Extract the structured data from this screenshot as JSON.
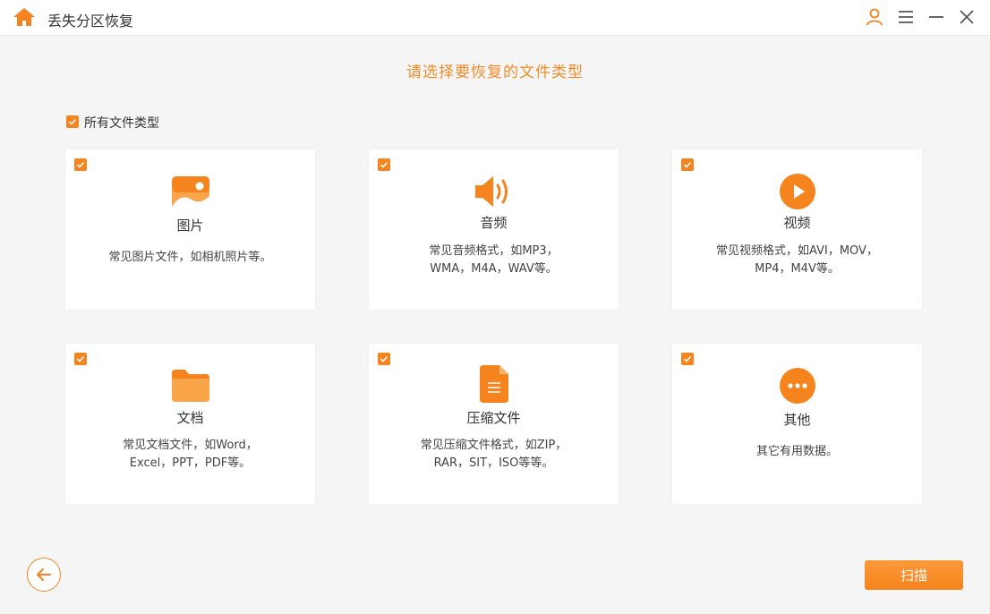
{
  "window": {
    "title": "丢失分区恢复"
  },
  "heading": "请选择要恢复的文件类型",
  "all_types": {
    "label": "所有文件类型",
    "checked": true
  },
  "cards": [
    {
      "icon": "image-icon",
      "title": "图片",
      "desc_line1": "常见图片文件，如相机照片等。",
      "desc_line2": "",
      "checked": true
    },
    {
      "icon": "audio-icon",
      "title": "音频",
      "desc_line1": "常见音频格式，如MP3，",
      "desc_line2": "WMA，M4A，WAV等。",
      "checked": true
    },
    {
      "icon": "video-play-icon",
      "title": "视频",
      "desc_line1": "常见视频格式，如AVI，MOV，",
      "desc_line2": "MP4，M4V等。",
      "checked": true
    },
    {
      "icon": "folder-icon",
      "title": "文档",
      "desc_line1": "常见文档文件，如Word，",
      "desc_line2": "Excel，PPT，PDF等。",
      "checked": true
    },
    {
      "icon": "archive-file-icon",
      "title": "压缩文件",
      "desc_line1": "常见压缩文件格式，如ZIP，",
      "desc_line2": "RAR，SIT，ISO等等。",
      "checked": true
    },
    {
      "icon": "more-icon",
      "title": "其他",
      "desc_line1": "其它有用数据。",
      "desc_line2": "",
      "checked": true
    }
  ],
  "footer": {
    "scan_label": "扫描"
  },
  "colors": {
    "accent": "#f5841f",
    "heading": "#f28c28",
    "background": "#f5f5f5"
  }
}
